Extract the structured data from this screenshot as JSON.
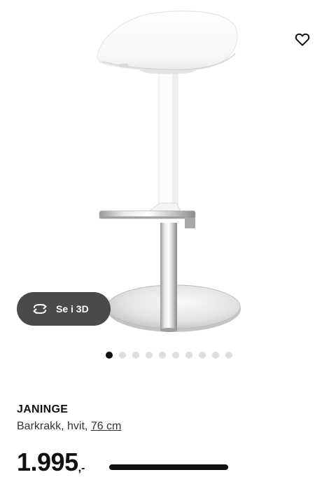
{
  "product": {
    "name": "JANINGE",
    "description": "Barkrakk, hvit,",
    "size_link": "76 cm",
    "price_amount": "1.995",
    "price_suffix": ",-"
  },
  "gallery": {
    "total_images": 10,
    "active_index": 0,
    "view_3d_label": "Se i 3D",
    "view_3d_icon": "rotate-3d-icon",
    "favorite_icon": "heart-outline-icon"
  }
}
